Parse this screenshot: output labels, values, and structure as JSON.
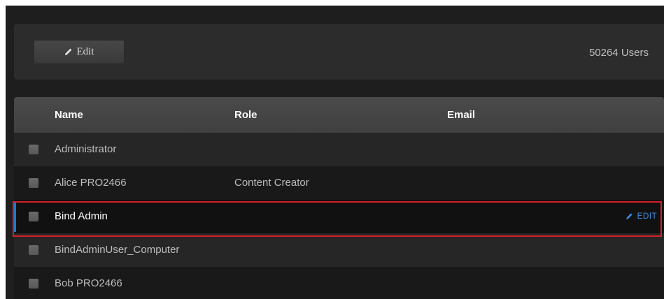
{
  "toolbar": {
    "edit_label": "Edit",
    "edit_icon": "pencil-icon",
    "user_count": "50264 Users"
  },
  "table": {
    "columns": [
      "Name",
      "Role",
      "Email"
    ],
    "rows": [
      {
        "name": "Administrator",
        "role": "",
        "email": ""
      },
      {
        "name": "Alice PRO2466",
        "role": "Content Creator",
        "email": ""
      },
      {
        "name": "Bind Admin",
        "role": "",
        "email": "",
        "selected": true,
        "action": "EDIT"
      },
      {
        "name": "BindAdminUser_Computer",
        "role": "",
        "email": ""
      },
      {
        "name": "Bob PRO2466",
        "role": "",
        "email": ""
      }
    ]
  },
  "colors": {
    "background": "#1e1e1e",
    "header": "#444444",
    "accent": "#2b73c4",
    "highlight": "#d81f26"
  }
}
